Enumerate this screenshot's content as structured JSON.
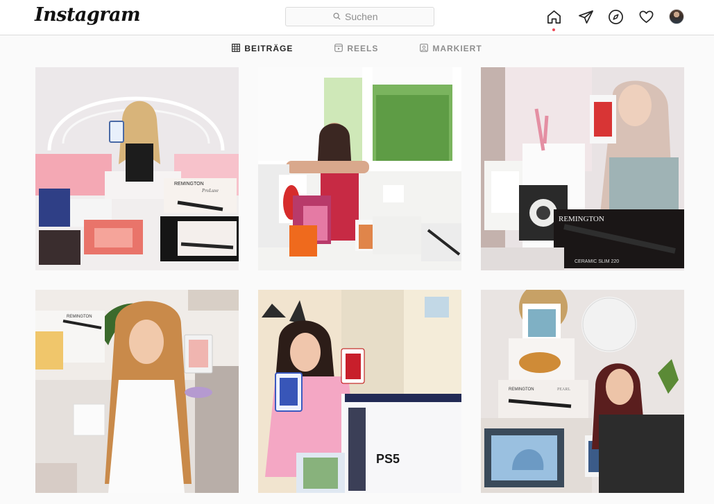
{
  "app": {
    "logo_text": "Instagram"
  },
  "search": {
    "placeholder": "Suchen"
  },
  "nav": {
    "icons": [
      "home-icon",
      "direct-message-icon",
      "explore-icon",
      "activity-heart-icon",
      "profile-avatar"
    ]
  },
  "tabs": [
    {
      "label": "BEITRÄGE",
      "icon": "grid-icon",
      "active": true
    },
    {
      "label": "REELS",
      "icon": "reels-icon",
      "active": false
    },
    {
      "label": "MARKIERT",
      "icon": "tagged-icon",
      "active": false
    }
  ],
  "posts": [
    {
      "remington_label": "REMINGTON",
      "product_label": "ProLuxe"
    },
    {
      "remington_label": "",
      "product_label": ""
    },
    {
      "remington_label": "REMINGTON",
      "product_label": "CERAMIC SLIM 220"
    },
    {
      "remington_label": "REMINGTON",
      "product_label": ""
    },
    {
      "remington_label": "",
      "product_label": "PS5"
    },
    {
      "remington_label": "REMINGTON",
      "product_label": "PEARL"
    }
  ],
  "colors": {
    "accent_red": "#ed4956",
    "border": "#dbdbdb",
    "background": "#fafafa",
    "text_secondary": "#8e8e8e"
  }
}
